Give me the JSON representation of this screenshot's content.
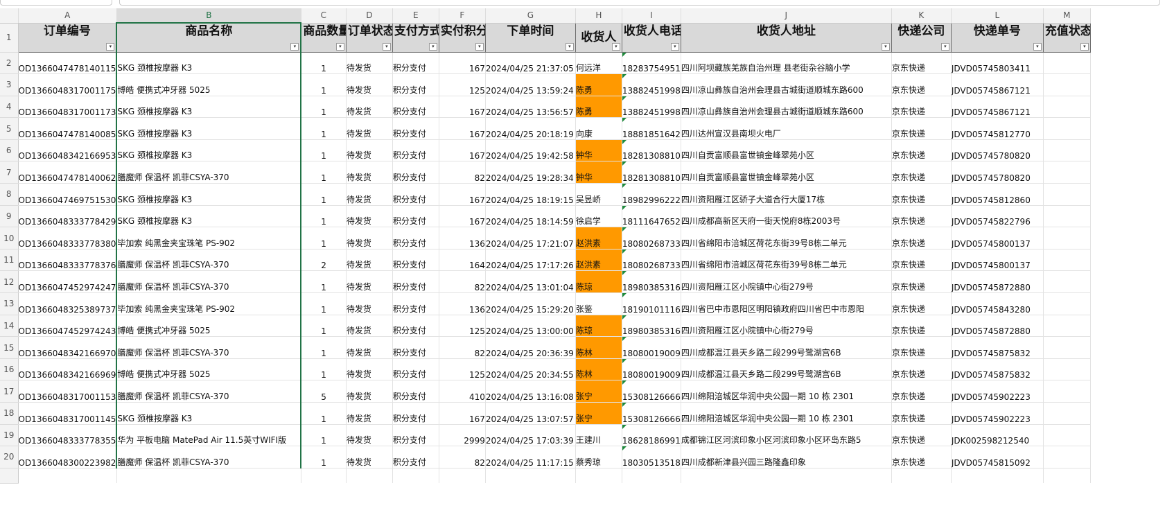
{
  "columns": [
    "A",
    "B",
    "C",
    "D",
    "E",
    "F",
    "G",
    "H",
    "I",
    "J",
    "K",
    "L",
    "M"
  ],
  "headers": [
    "订单编号",
    "商品名称",
    "商品数量",
    "订单状态",
    "支付方式",
    "实付积分",
    "下单时间",
    "收货人",
    "收货人电话",
    "收货人地址",
    "快递公司",
    "快递单号",
    "充值状态"
  ],
  "row_numbers": [
    "1",
    "2",
    "3",
    "4",
    "5",
    "6",
    "7",
    "8",
    "9",
    "10",
    "11",
    "12",
    "13",
    "14",
    "15",
    "16",
    "17",
    "18",
    "19",
    "20"
  ],
  "filter_glyph": "▾",
  "highlight_color": "#ff9900",
  "rows": [
    {
      "order": "OD1366047478140115",
      "product": "SKG 颈椎按摩器 K3",
      "qty": "1",
      "status": "待发货",
      "pay": "积分支付",
      "points": "167",
      "time": "2024/04/25 21:37:05",
      "name": "何远洋",
      "hl": false,
      "phone": "18283754951",
      "addr": "四川阿坝藏族羌族自治州理 县老街杂谷脑小学",
      "courier": "京东快递",
      "tracking": "JDVD05745803411",
      "recharge": ""
    },
    {
      "order": "OD1366048317001175",
      "product": "博皓 便携式冲牙器 5025",
      "qty": "1",
      "status": "待发货",
      "pay": "积分支付",
      "points": "125",
      "time": "2024/04/25 13:59:24",
      "name": "陈勇",
      "hl": true,
      "phone": "13882451998",
      "addr": "四川凉山彝族自治州会理县古城街道顺城东路600",
      "courier": "京东快递",
      "tracking": "JDVD05745867121",
      "recharge": ""
    },
    {
      "order": "OD1366048317001173",
      "product": "SKG 颈椎按摩器 K3",
      "qty": "1",
      "status": "待发货",
      "pay": "积分支付",
      "points": "167",
      "time": "2024/04/25 13:56:57",
      "name": "陈勇",
      "hl": true,
      "phone": "13882451998",
      "addr": "四川凉山彝族自治州会理县古城街道顺城东路600",
      "courier": "京东快递",
      "tracking": "JDVD05745867121",
      "recharge": ""
    },
    {
      "order": "OD1366047478140085",
      "product": "SKG 颈椎按摩器 K3",
      "qty": "1",
      "status": "待发货",
      "pay": "积分支付",
      "points": "167",
      "time": "2024/04/25 20:18:19",
      "name": "向康",
      "hl": false,
      "phone": "18881851642",
      "addr": "四川达州宣汉县南坝火电厂",
      "courier": "京东快递",
      "tracking": "JDVD05745812770",
      "recharge": ""
    },
    {
      "order": "OD1366048342166953",
      "product": "SKG 颈椎按摩器 K3",
      "qty": "1",
      "status": "待发货",
      "pay": "积分支付",
      "points": "167",
      "time": "2024/04/25 19:42:58",
      "name": "钟华",
      "hl": true,
      "phone": "18281308810",
      "addr": "四川自贡富顺县富世镇金峰翠苑小区",
      "courier": "京东快递",
      "tracking": "JDVD05745780820",
      "recharge": ""
    },
    {
      "order": "OD1366047478140062",
      "product": "膳魔师 保温杯 凯菲CSYA-370",
      "qty": "1",
      "status": "待发货",
      "pay": "积分支付",
      "points": "82",
      "time": "2024/04/25 19:28:34",
      "name": "钟华",
      "hl": true,
      "phone": "18281308810",
      "addr": "四川自贡富顺县富世镇金峰翠苑小区",
      "courier": "京东快递",
      "tracking": "JDVD05745780820",
      "recharge": ""
    },
    {
      "order": "OD1366047469751530",
      "product": "SKG 颈椎按摩器 K3",
      "qty": "1",
      "status": "待发货",
      "pay": "积分支付",
      "points": "167",
      "time": "2024/04/25 18:19:15",
      "name": "吴昱峤",
      "hl": false,
      "phone": "18982996222",
      "addr": "四川资阳雁江区骄子大道合行大厦17栋",
      "courier": "京东快递",
      "tracking": "JDVD05745812860",
      "recharge": ""
    },
    {
      "order": "OD1366048333778429",
      "product": "SKG 颈椎按摩器 K3",
      "qty": "1",
      "status": "待发货",
      "pay": "积分支付",
      "points": "167",
      "time": "2024/04/25 18:14:59",
      "name": "徐启学",
      "hl": false,
      "phone": "18111647652",
      "addr": "四川成都高新区天府一街天悦府8栋2003号",
      "courier": "京东快递",
      "tracking": "JDVD05745822796",
      "recharge": ""
    },
    {
      "order": "OD1366048333778380",
      "product": "毕加索 纯黑金夹宝珠笔 PS-902",
      "qty": "1",
      "status": "待发货",
      "pay": "积分支付",
      "points": "136",
      "time": "2024/04/25 17:21:07",
      "name": "赵洪素",
      "hl": true,
      "phone": "18080268733",
      "addr": "四川省绵阳市涪城区荷花东街39号8栋二单元",
      "courier": "京东快递",
      "tracking": "JDVD05745800137",
      "recharge": ""
    },
    {
      "order": "OD1366048333778376",
      "product": "膳魔师 保温杯 凯菲CSYA-370",
      "qty": "2",
      "status": "待发货",
      "pay": "积分支付",
      "points": "164",
      "time": "2024/04/25 17:17:26",
      "name": "赵洪素",
      "hl": true,
      "phone": "18080268733",
      "addr": "四川省绵阳市涪城区荷花东街39号8栋二单元",
      "courier": "京东快递",
      "tracking": "JDVD05745800137",
      "recharge": ""
    },
    {
      "order": "OD1366047452974247",
      "product": "膳魔师 保温杯 凯菲CSYA-370",
      "qty": "1",
      "status": "待发货",
      "pay": "积分支付",
      "points": "82",
      "time": "2024/04/25 13:01:04",
      "name": "陈琼",
      "hl": true,
      "phone": "18980385316",
      "addr": "四川资阳雁江区小院镇中心街279号",
      "courier": "京东快递",
      "tracking": "JDVD05745872880",
      "recharge": ""
    },
    {
      "order": "OD1366048325389737",
      "product": "毕加索 纯黑金夹宝珠笔 PS-902",
      "qty": "1",
      "status": "待发货",
      "pay": "积分支付",
      "points": "136",
      "time": "2024/04/25 15:29:20",
      "name": "张鉴",
      "hl": false,
      "phone": "18190101116",
      "addr": "四川省巴中市恩阳区明阳镇政府四川省巴中市恩阳",
      "courier": "京东快递",
      "tracking": "JDVD05745843280",
      "recharge": ""
    },
    {
      "order": "OD1366047452974243",
      "product": "博皓 便携式冲牙器 5025",
      "qty": "1",
      "status": "待发货",
      "pay": "积分支付",
      "points": "125",
      "time": "2024/04/25 13:00:00",
      "name": "陈琼",
      "hl": true,
      "phone": "18980385316",
      "addr": "四川资阳雁江区小院镇中心街279号",
      "courier": "京东快递",
      "tracking": "JDVD05745872880",
      "recharge": ""
    },
    {
      "order": "OD1366048342166970",
      "product": "膳魔师 保温杯 凯菲CSYA-370",
      "qty": "1",
      "status": "待发货",
      "pay": "积分支付",
      "points": "82",
      "time": "2024/04/25 20:36:39",
      "name": "陈林",
      "hl": true,
      "phone": "18080019009",
      "addr": "四川成都温江县天乡路二段299号鹭湖宫6B",
      "courier": "京东快递",
      "tracking": "JDVD05745875832",
      "recharge": ""
    },
    {
      "order": "OD1366048342166969",
      "product": "博皓 便携式冲牙器 5025",
      "qty": "1",
      "status": "待发货",
      "pay": "积分支付",
      "points": "125",
      "time": "2024/04/25 20:34:55",
      "name": "陈林",
      "hl": true,
      "phone": "18080019009",
      "addr": "四川成都温江县天乡路二段299号鹭湖宫6B",
      "courier": "京东快递",
      "tracking": "JDVD05745875832",
      "recharge": ""
    },
    {
      "order": "OD1366048317001153",
      "product": "膳魔师 保温杯 凯菲CSYA-370",
      "qty": "5",
      "status": "待发货",
      "pay": "积分支付",
      "points": "410",
      "time": "2024/04/25 13:16:08",
      "name": "张宁",
      "hl": true,
      "phone": "15308126666",
      "addr": "四川绵阳涪城区华润中央公园一期 10 栋 2301",
      "courier": "京东快递",
      "tracking": "JDVD05745902223",
      "recharge": ""
    },
    {
      "order": "OD1366048317001145",
      "product": "SKG 颈椎按摩器 K3",
      "qty": "1",
      "status": "待发货",
      "pay": "积分支付",
      "points": "167",
      "time": "2024/04/25 13:07:57",
      "name": "张宁",
      "hl": true,
      "phone": "15308126666",
      "addr": "四川绵阳涪城区华润中央公园一期 10 栋 2301",
      "courier": "京东快递",
      "tracking": "JDVD05745902223",
      "recharge": ""
    },
    {
      "order": "OD1366048333778355",
      "product": "华为 平板电脑 MatePad Air 11.5英寸WIFI版",
      "qty": "1",
      "status": "待发货",
      "pay": "积分支付",
      "points": "2999",
      "time": "2024/04/25 17:03:39",
      "name": "王建川",
      "hl": false,
      "phone": "18628186991",
      "addr": "成都锦江区河滨印象小区河滨印象小区环岛东路5",
      "courier": "京东快递",
      "tracking": "JDK002598212540",
      "recharge": ""
    },
    {
      "order": "OD1366048300223982",
      "product": "膳魔师 保温杯 凯菲CSYA-370",
      "qty": "1",
      "status": "待发货",
      "pay": "积分支付",
      "points": "82",
      "time": "2024/04/25 11:17:15",
      "name": "蔡秀琼",
      "hl": false,
      "phone": "18030513518",
      "addr": "四川成都新津县兴园三路隆鑫印象",
      "courier": "京东快递",
      "tracking": "JDVD05745815092",
      "recharge": ""
    }
  ]
}
